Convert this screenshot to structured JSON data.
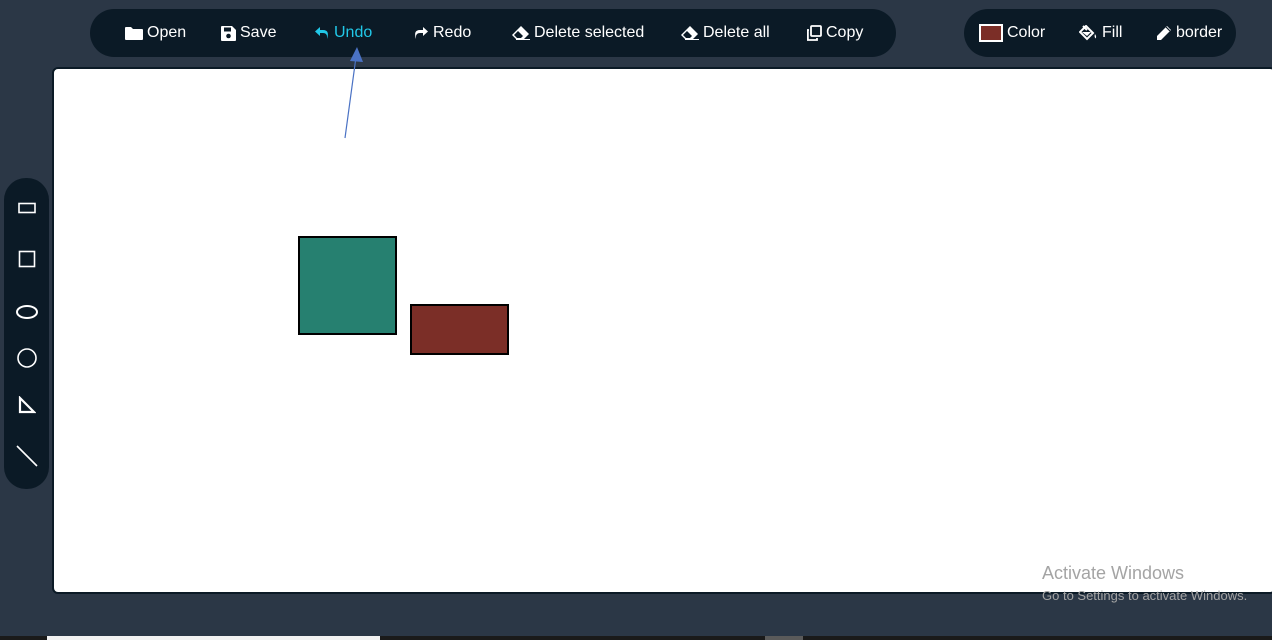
{
  "toolbar": {
    "open": "Open",
    "save": "Save",
    "undo": "Undo",
    "redo": "Redo",
    "delete_selected": "Delete selected",
    "delete_all": "Delete all",
    "copy": "Copy"
  },
  "style_toolbar": {
    "color": "Color",
    "fill": "Fill",
    "border": "border",
    "current_color": "#7b2e27"
  },
  "side_tools": [
    {
      "icon": "rectangle-icon"
    },
    {
      "icon": "square-icon"
    },
    {
      "icon": "ellipse-icon"
    },
    {
      "icon": "circle-icon"
    },
    {
      "icon": "triangle-icon"
    },
    {
      "icon": "line-icon"
    }
  ],
  "canvas_shapes": [
    {
      "type": "square",
      "fill": "#268070"
    },
    {
      "type": "rectangle",
      "fill": "#7b2e27"
    }
  ],
  "colors": {
    "accent": "#21c8e8",
    "bar": "#0b1a26",
    "background": "#2b3746",
    "arrow": "#4a72c4"
  },
  "watermark": {
    "line1": "Activate Windows",
    "line2": "Go to Settings to activate Windows."
  }
}
